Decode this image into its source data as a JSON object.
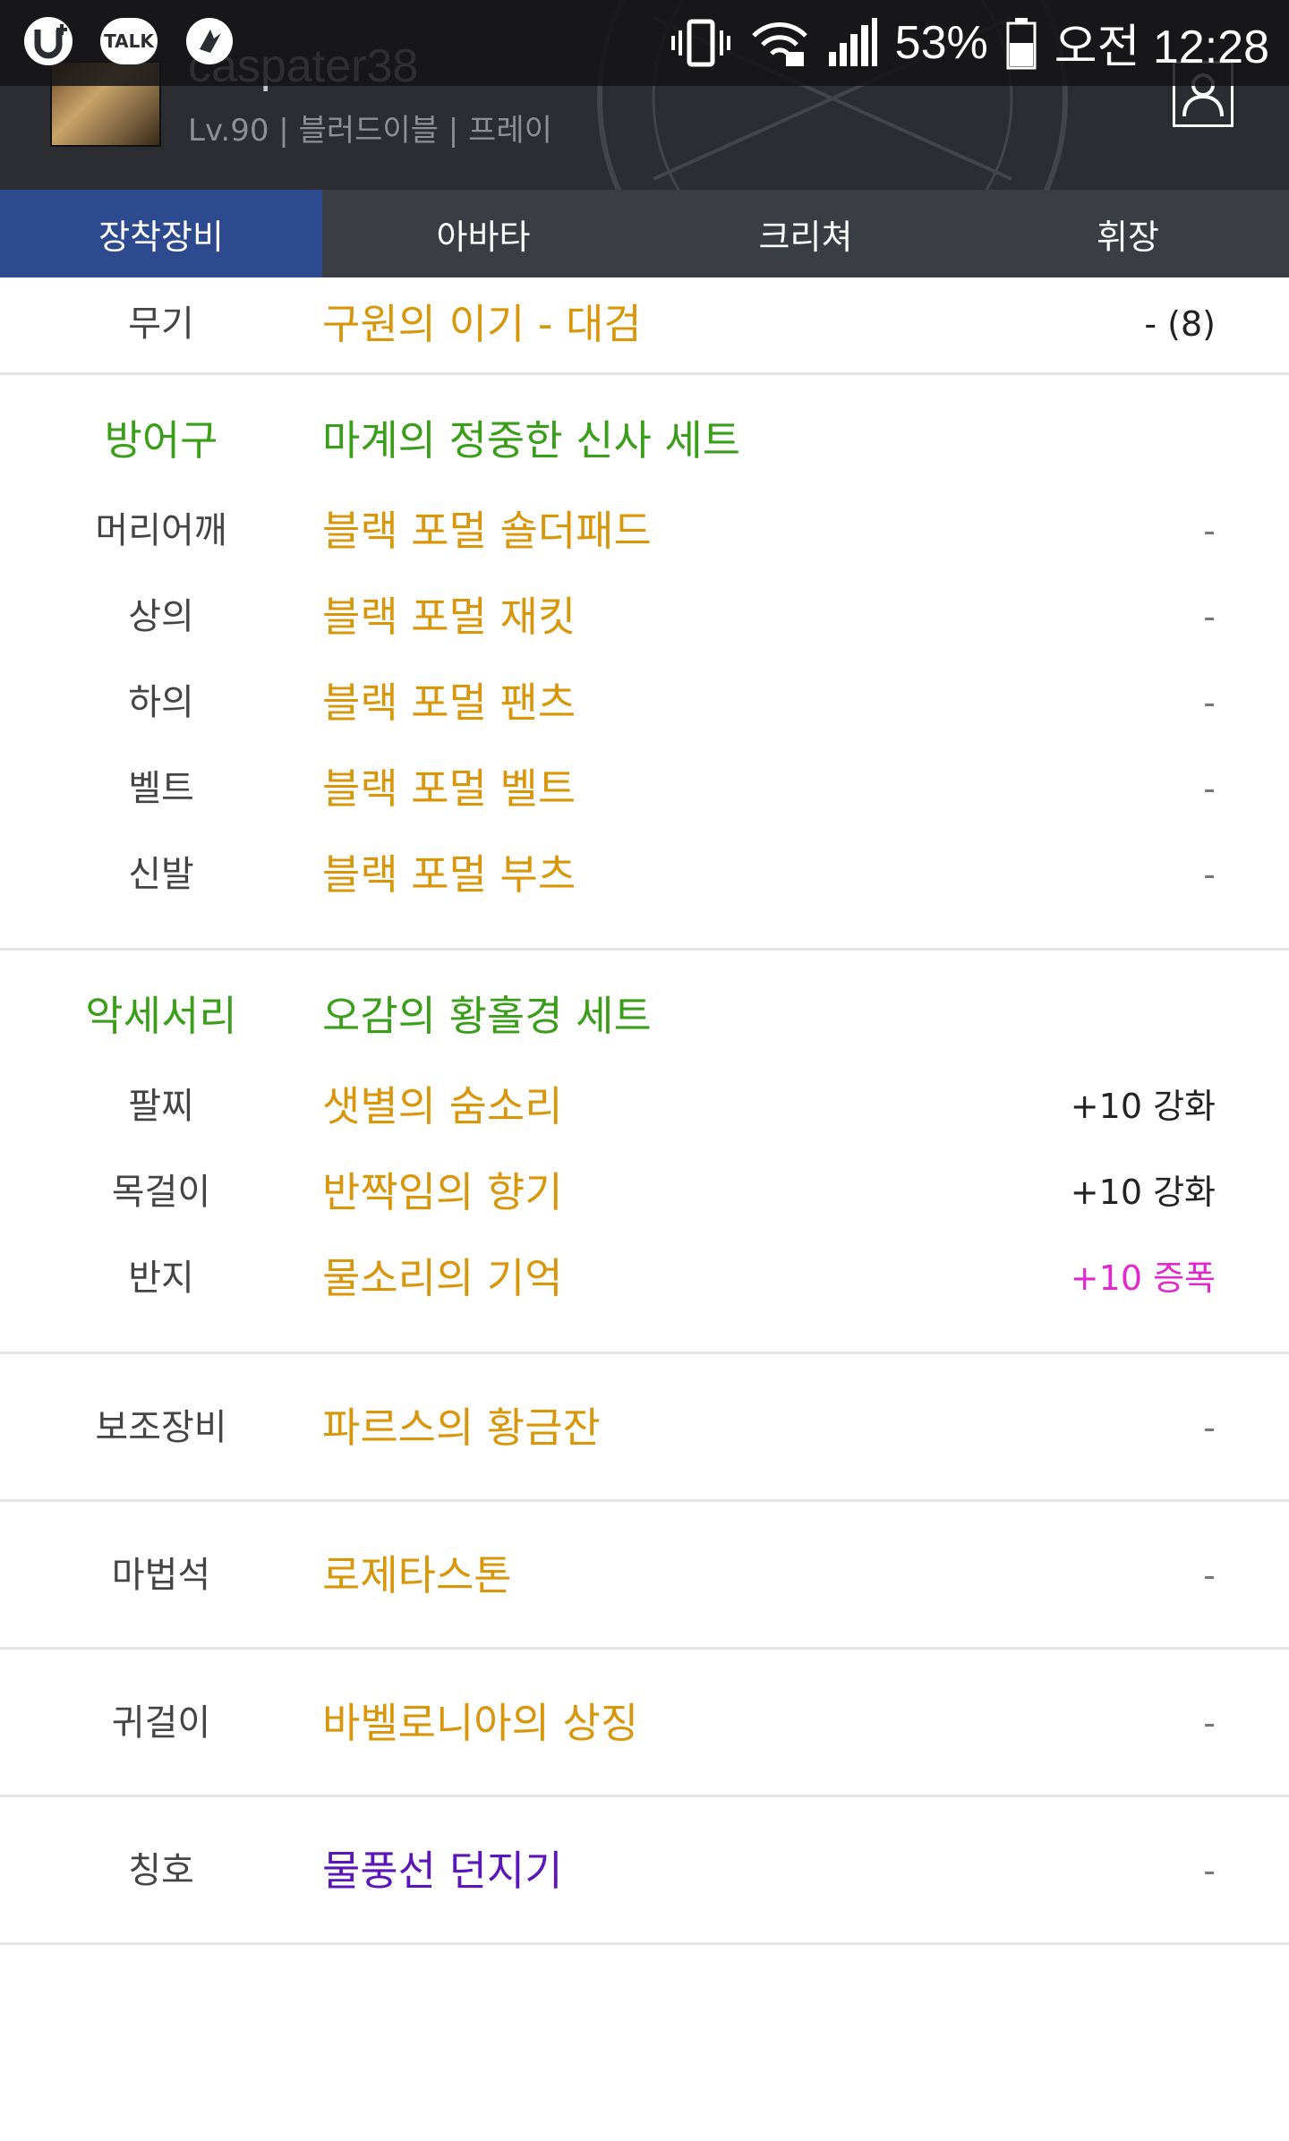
{
  "status_bar": {
    "talk_label": "TALK",
    "battery": "53%",
    "time": "오전 12:28",
    "icons": [
      "u-plus-icon",
      "kakao-talk-icon",
      "app-icon",
      "vibrate-icon",
      "wifi-lock-icon",
      "signal-icon",
      "battery-icon"
    ]
  },
  "profile": {
    "name": "caspater38",
    "sub": "Lv.90 | 블러드이블 | 프레이"
  },
  "tabs": [
    {
      "label": "장착장비",
      "active": true
    },
    {
      "label": "아바타",
      "active": false
    },
    {
      "label": "크리쳐",
      "active": false
    },
    {
      "label": "휘장",
      "active": false
    }
  ],
  "sections": {
    "weapon": {
      "rows": [
        {
          "label": "무기",
          "item": "구원의 이기 - 대검",
          "value": "- (8)"
        }
      ]
    },
    "armor": {
      "set_label": "방어구",
      "set_name": "마계의 정중한 신사 세트",
      "rows": [
        {
          "label": "머리어깨",
          "item": "블랙 포멀 숄더패드",
          "value": "-"
        },
        {
          "label": "상의",
          "item": "블랙 포멀 재킷",
          "value": "-"
        },
        {
          "label": "하의",
          "item": "블랙 포멀 팬츠",
          "value": "-"
        },
        {
          "label": "벨트",
          "item": "블랙 포멀 벨트",
          "value": "-"
        },
        {
          "label": "신발",
          "item": "블랙 포멀 부츠",
          "value": "-"
        }
      ]
    },
    "accessory": {
      "set_label": "악세서리",
      "set_name": "오감의 황홀경 세트",
      "rows": [
        {
          "label": "팔찌",
          "item": "샛별의 숨소리",
          "value": "+10 강화"
        },
        {
          "label": "목걸이",
          "item": "반짝임의 향기",
          "value": "+10 강화"
        },
        {
          "label": "반지",
          "item": "물소리의 기억",
          "value": "+10 증폭"
        }
      ]
    },
    "sub_equipment": {
      "rows": [
        {
          "label": "보조장비",
          "item": "파르스의 황금잔",
          "value": "-"
        }
      ]
    },
    "magic_stone": {
      "rows": [
        {
          "label": "마법석",
          "item": "로제타스톤",
          "value": "-"
        }
      ]
    },
    "earring": {
      "rows": [
        {
          "label": "귀걸이",
          "item": "바벨로니아의 상징",
          "value": "-"
        }
      ]
    },
    "title": {
      "rows": [
        {
          "label": "칭호",
          "item": "물풍선 던지기",
          "value": "-"
        }
      ]
    }
  },
  "colors": {
    "item_gold": "#d8960a",
    "set_green": "#3a9e1a",
    "amplify_magenta": "#e028cc",
    "title_purple": "#5a16b8",
    "active_tab": "#2e4a8f"
  }
}
